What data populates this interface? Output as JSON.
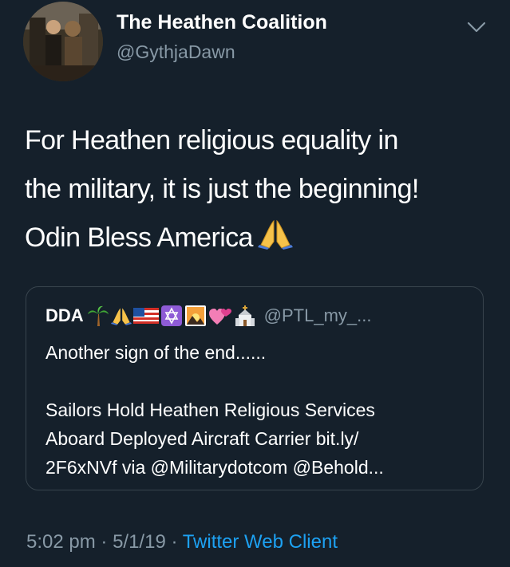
{
  "author": {
    "display_name": "The Heathen Coalition",
    "handle": "@GythjaDawn"
  },
  "tweet": {
    "lines": [
      "For Heathen religious equality in",
      "the military, it is just the beginning!",
      "Odin Bless America"
    ]
  },
  "quoted": {
    "name": "DDA",
    "emoji_icons": [
      "palm-tree-icon",
      "praying-hands-icon",
      "us-flag-icon",
      "star-of-david-icon",
      "sunrise-icon",
      "hearts-icon",
      "church-icon"
    ],
    "handle": "@PTL_my_...",
    "text_line1": "Another sign of the end......",
    "text_lines": [
      "Sailors Hold Heathen Religious Services",
      "Aboard Deployed Aircraft Carrier bit.ly/",
      "2F6xNVf via @Militarydotcom @Behold..."
    ]
  },
  "meta": {
    "time": "5:02 pm",
    "separator": "·",
    "date": "5/1/19",
    "client": "Twitter Web Client"
  },
  "colors": {
    "background": "#15202b",
    "secondary_text": "#8899a6",
    "link": "#1da1f2",
    "border": "#38444d"
  }
}
